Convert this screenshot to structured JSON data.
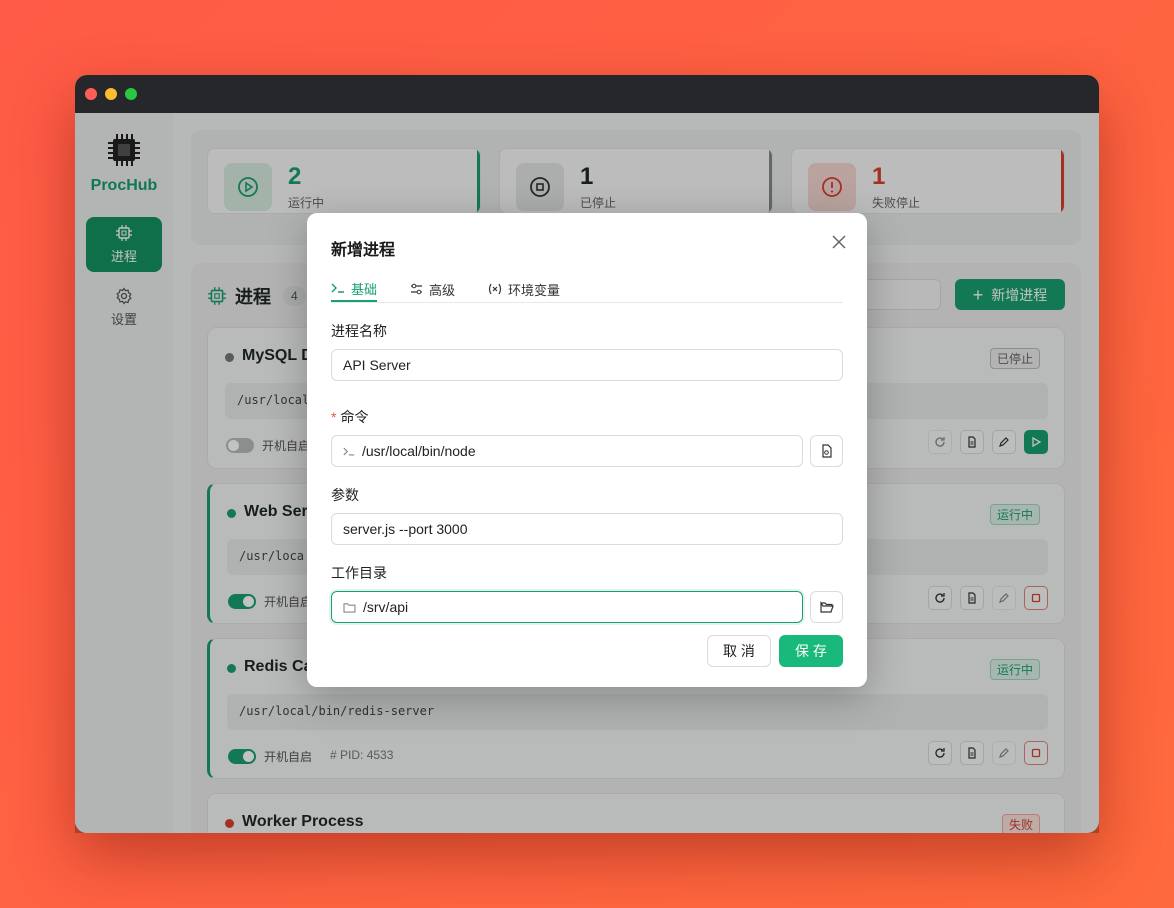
{
  "app": {
    "brand": "ProcHub"
  },
  "sidebar": {
    "items": [
      {
        "label": "进程",
        "icon": "chip-icon"
      },
      {
        "label": "设置",
        "icon": "gear-icon"
      }
    ]
  },
  "stats": [
    {
      "value": "2",
      "label": "运行中",
      "color": "#18a06f"
    },
    {
      "value": "1",
      "label": "已停止",
      "color": "#888888"
    },
    {
      "value": "1",
      "label": "失败停止",
      "color": "#d6412f"
    }
  ],
  "process_panel": {
    "title": "进程",
    "count": "4",
    "add_button": "新增进程"
  },
  "processes": [
    {
      "name": "MySQL D",
      "badge": "已停止",
      "command": "/usr/local",
      "auto_start": "开机自启",
      "pid": ""
    },
    {
      "name": "Web Ser",
      "badge": "运行中",
      "command": "/usr/loca",
      "auto_start": "开机自启",
      "pid": ""
    },
    {
      "name": "Redis Ca",
      "badge": "运行中",
      "command": "/usr/local/bin/redis-server",
      "auto_start": "开机自启",
      "pid": "PID: 4533"
    },
    {
      "name": "Worker Process",
      "badge": "失败",
      "command": "",
      "auto_start": "",
      "pid": ""
    }
  ],
  "modal": {
    "title": "新增进程",
    "tabs": [
      {
        "label": "基础"
      },
      {
        "label": "高级"
      },
      {
        "label": "环境变量"
      }
    ],
    "fields": {
      "name": {
        "label": "进程名称",
        "value": "API Server"
      },
      "command": {
        "required_mark": "*",
        "label": "命令",
        "value": "/usr/local/bin/node"
      },
      "args": {
        "label": "参数",
        "value": "server.js --port 3000"
      },
      "workdir": {
        "label": "工作目录",
        "value": "/srv/api"
      }
    },
    "cancel": "取 消",
    "save": "保 存"
  }
}
